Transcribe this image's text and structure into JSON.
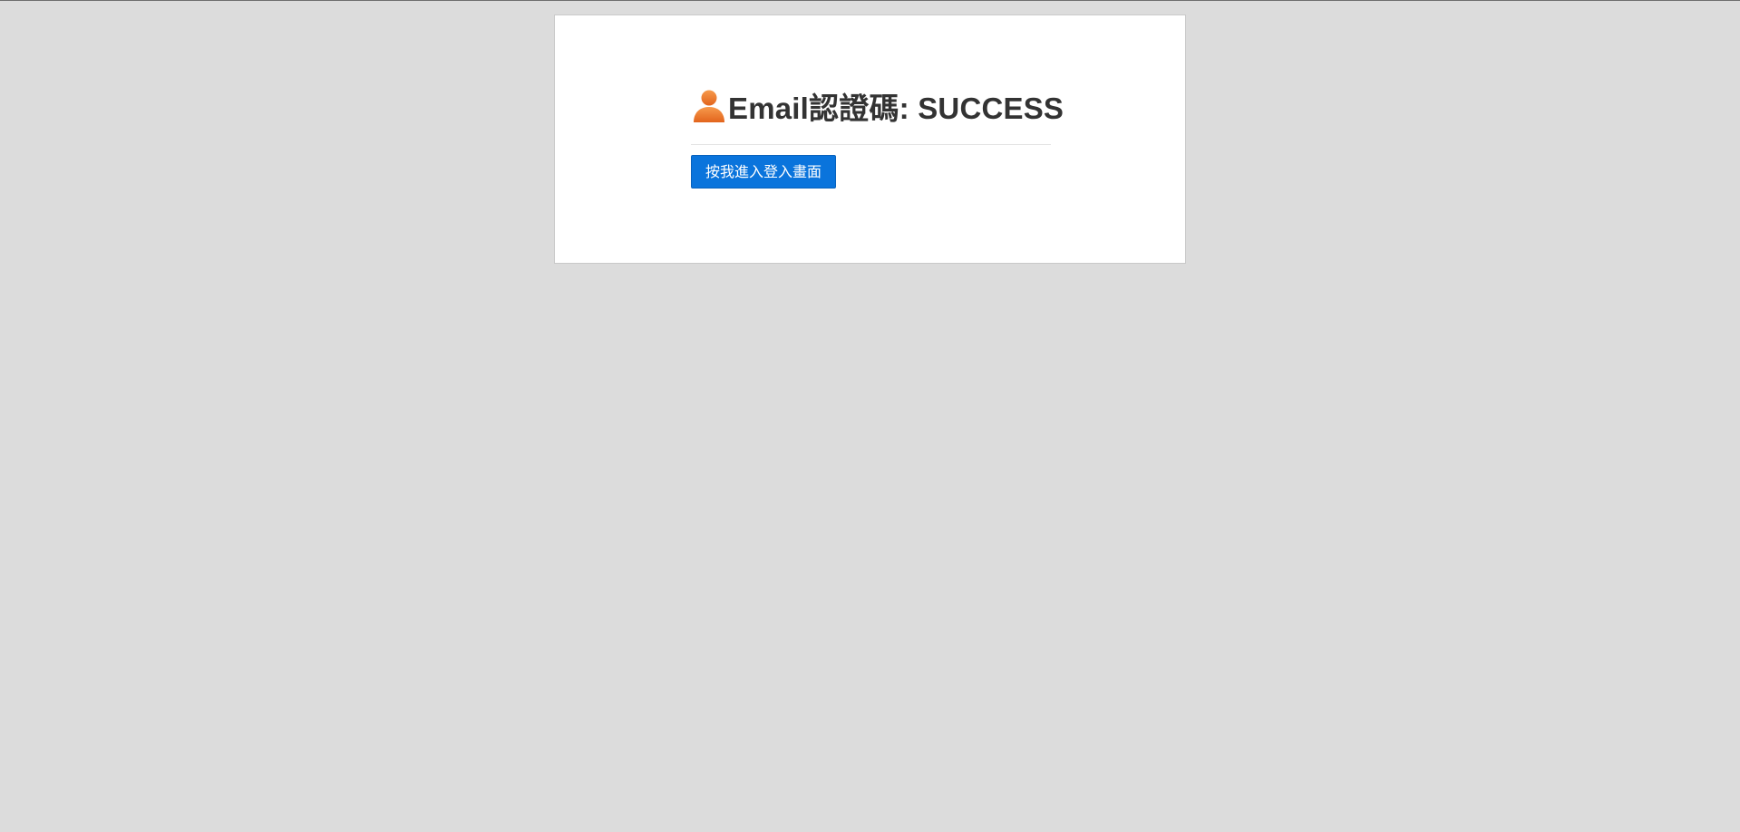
{
  "heading": {
    "icon": "user-icon",
    "text": "Email認證碼: SUCCESS"
  },
  "login_button": {
    "label": "按我進入登入畫面"
  },
  "colors": {
    "page_background": "#dcdcdc",
    "card_background": "#ffffff",
    "button_background": "#0a74dc",
    "icon_orange": "#f07a2b",
    "heading_text": "#333333"
  }
}
